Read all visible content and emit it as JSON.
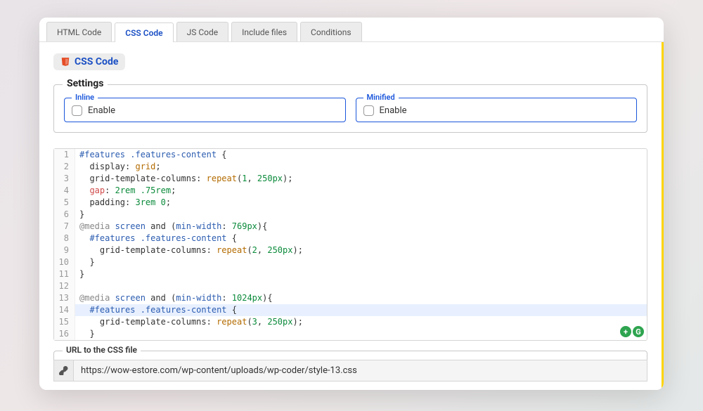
{
  "tabs": [
    {
      "label": "HTML Code",
      "active": false
    },
    {
      "label": "CSS Code",
      "active": true
    },
    {
      "label": "JS Code",
      "active": false
    },
    {
      "label": "Include files",
      "active": false
    },
    {
      "label": "Conditions",
      "active": false
    }
  ],
  "section": {
    "title": "CSS Code"
  },
  "settings": {
    "legend": "Settings",
    "inline": {
      "legend": "Inline",
      "label": "Enable"
    },
    "minified": {
      "legend": "Minified",
      "label": "Enable"
    }
  },
  "code": {
    "lines": [
      {
        "n": 1,
        "hl": false,
        "tokens": [
          [
            "sel",
            "#features .features-content "
          ],
          [
            "plain",
            "{"
          ]
        ]
      },
      {
        "n": 2,
        "hl": false,
        "tokens": [
          [
            "plain",
            "  "
          ],
          [
            "prop",
            "display"
          ],
          [
            "plain",
            ": "
          ],
          [
            "val",
            "grid"
          ],
          [
            "plain",
            ";"
          ]
        ]
      },
      {
        "n": 3,
        "hl": false,
        "tokens": [
          [
            "plain",
            "  "
          ],
          [
            "prop",
            "grid-template-columns"
          ],
          [
            "plain",
            ": "
          ],
          [
            "val",
            "repeat"
          ],
          [
            "plain",
            "("
          ],
          [
            "num",
            "1"
          ],
          [
            "plain",
            ", "
          ],
          [
            "num",
            "250px"
          ],
          [
            "plain",
            ");"
          ]
        ]
      },
      {
        "n": 4,
        "hl": false,
        "tokens": [
          [
            "plain",
            "  "
          ],
          [
            "kw",
            "gap"
          ],
          [
            "plain",
            ": "
          ],
          [
            "num",
            "2rem .75rem"
          ],
          [
            "plain",
            ";"
          ]
        ]
      },
      {
        "n": 5,
        "hl": false,
        "tokens": [
          [
            "plain",
            "  "
          ],
          [
            "prop",
            "padding"
          ],
          [
            "plain",
            ": "
          ],
          [
            "num",
            "3rem 0"
          ],
          [
            "plain",
            ";"
          ]
        ]
      },
      {
        "n": 6,
        "hl": false,
        "tokens": [
          [
            "plain",
            "}"
          ]
        ]
      },
      {
        "n": 7,
        "hl": false,
        "tokens": [
          [
            "rule",
            "@media "
          ],
          [
            "sel",
            "screen "
          ],
          [
            "prop",
            "and "
          ],
          [
            "plain",
            "("
          ],
          [
            "sel",
            "min-width"
          ],
          [
            "plain",
            ": "
          ],
          [
            "num",
            "769px"
          ],
          [
            "plain",
            "){"
          ]
        ]
      },
      {
        "n": 8,
        "hl": false,
        "tokens": [
          [
            "plain",
            "  "
          ],
          [
            "sel",
            "#features .features-content "
          ],
          [
            "plain",
            "{"
          ]
        ]
      },
      {
        "n": 9,
        "hl": false,
        "tokens": [
          [
            "plain",
            "    "
          ],
          [
            "prop",
            "grid-template-columns"
          ],
          [
            "plain",
            ": "
          ],
          [
            "val",
            "repeat"
          ],
          [
            "plain",
            "("
          ],
          [
            "num",
            "2"
          ],
          [
            "plain",
            ", "
          ],
          [
            "num",
            "250px"
          ],
          [
            "plain",
            ");"
          ]
        ]
      },
      {
        "n": 10,
        "hl": false,
        "tokens": [
          [
            "plain",
            "  }"
          ]
        ]
      },
      {
        "n": 11,
        "hl": false,
        "tokens": [
          [
            "plain",
            "}"
          ]
        ]
      },
      {
        "n": 12,
        "hl": false,
        "tokens": [
          [
            "plain",
            ""
          ]
        ]
      },
      {
        "n": 13,
        "hl": false,
        "tokens": [
          [
            "rule",
            "@media "
          ],
          [
            "sel",
            "screen "
          ],
          [
            "prop",
            "and "
          ],
          [
            "plain",
            "("
          ],
          [
            "sel",
            "min-width"
          ],
          [
            "plain",
            ": "
          ],
          [
            "num",
            "1024px"
          ],
          [
            "plain",
            "){"
          ]
        ]
      },
      {
        "n": 14,
        "hl": true,
        "tokens": [
          [
            "plain",
            "  "
          ],
          [
            "sel",
            "#features .features-content "
          ],
          [
            "plain",
            "{"
          ]
        ]
      },
      {
        "n": 15,
        "hl": false,
        "tokens": [
          [
            "plain",
            "    "
          ],
          [
            "prop",
            "grid-template-columns"
          ],
          [
            "plain",
            ": "
          ],
          [
            "val",
            "repeat"
          ],
          [
            "plain",
            "("
          ],
          [
            "num",
            "3"
          ],
          [
            "plain",
            ", "
          ],
          [
            "num",
            "250px"
          ],
          [
            "plain",
            ");"
          ]
        ]
      },
      {
        "n": 16,
        "hl": false,
        "tokens": [
          [
            "plain",
            "  }"
          ]
        ]
      }
    ]
  },
  "url": {
    "legend": "URL to the CSS file",
    "value": "https://wow-estore.com/wp-content/uploads/wp-coder/style-13.css"
  }
}
